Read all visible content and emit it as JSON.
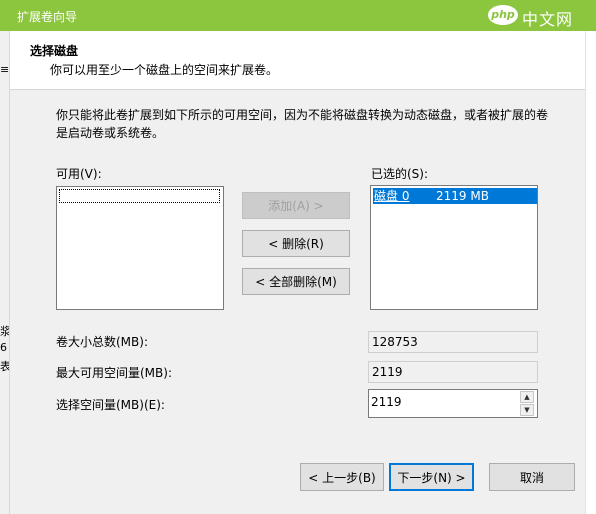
{
  "window": {
    "title": "扩展卷向导"
  },
  "watermark": {
    "logo_text": "php",
    "site_text": "中文网"
  },
  "background_fragments": [
    "≡",
    "浆",
    "6",
    "表"
  ],
  "header": {
    "title": "选择磁盘",
    "subtitle": "你可以用至少一个磁盘上的空间来扩展卷。"
  },
  "description": "你只能将此卷扩展到如下所示的可用空间，因为不能将磁盘转换为动态磁盘，或者被扩展的卷是启动卷或系统卷。",
  "available": {
    "label": "可用(V):",
    "items": []
  },
  "selected": {
    "label": "已选的(S):",
    "items": [
      {
        "disk": "磁盘 0",
        "size": "2119 MB"
      }
    ]
  },
  "buttons": {
    "add": "添加(A) >",
    "remove": "< 删除(R)",
    "remove_all": "< 全部删除(M)",
    "back": "< 上一步(B)",
    "next": "下一步(N) >",
    "cancel": "取消"
  },
  "fields": {
    "total_size": {
      "label": "卷大小总数(MB):",
      "value": "128753"
    },
    "max_space": {
      "label": "最大可用空间量(MB):",
      "value": "2119"
    },
    "select_space": {
      "label": "选择空间量(MB)(E):",
      "value": "2119"
    }
  },
  "colors": {
    "titlebar": "#8cc63f",
    "selection": "#0078d7"
  }
}
